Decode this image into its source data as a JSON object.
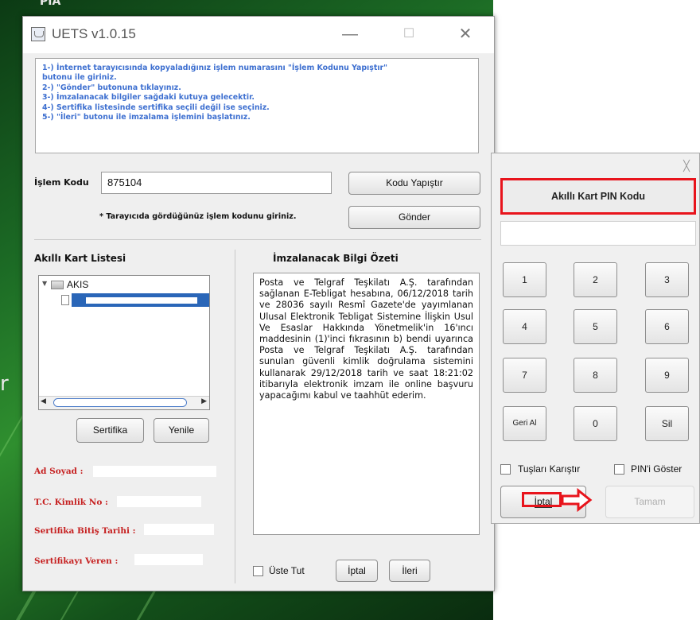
{
  "desktop": {
    "top_text": "PIA",
    "side_text": "r"
  },
  "window": {
    "title": "UETS v1.0.15",
    "minimize": "—",
    "maximize": "☐",
    "close": "✕"
  },
  "instructions": [
    "1-) İnternet tarayıcısında kopyaladığınız işlem numarasını \"İşlem Kodunu Yapıştır\"",
    "butonu ile giriniz.",
    "2-) \"Gönder\" butonuna tıklayınız.",
    "3-) İmzalanacak bilgiler sağdaki kutuya gelecektir.",
    "4-) Sertifika listesinde sertifika seçili değil ise seçiniz.",
    "5-) \"İleri\" butonu ile imzalama işlemini başlatınız."
  ],
  "form": {
    "code_label": "İşlem Kodu",
    "code_value": "875104",
    "paste_button": "Kodu Yapıştır",
    "hint": "* Tarayıcıda gördüğünüz işlem kodunu giriniz.",
    "send_button": "Gönder"
  },
  "cards": {
    "heading": "Akıllı Kart Listesi",
    "tree_root": "AKIS",
    "certificate_button": "Sertifika",
    "refresh_button": "Yenile"
  },
  "info_labels": {
    "name": "Ad Soyad :",
    "tc": "T.C. Kimlik No :",
    "expiry": "Sertifika Bitiş Tarihi :",
    "issuer": "Sertifikayı Veren :"
  },
  "summary": {
    "heading": "İmzalanacak Bilgi Özeti",
    "text": "Posta ve Telgraf Teşkilatı A.Ş. tarafından sağlanan E-Tebligat hesabına, 06/12/2018 tarih ve 28036 sayılı Resmî Gazete'de yayımlanan Ulusal Elektronik Tebligat Sistemine İlişkin Usul Ve Esaslar Hakkında Yönetmelik'in 16'ıncı maddesinin (1)'inci fıkrasının b) bendi uyarınca Posta ve Telgraf Teşkilatı A.Ş. tarafından sunulan güvenli kimlik doğrulama sistemini kullanarak 29/12/2018 tarih ve saat 18:21:02 itibarıyla elektronik imzam ile online başvuru yapacağımı kabul ve taahhüt ederim."
  },
  "bottom": {
    "stay_on_top": "Üste Tut",
    "cancel": "İptal",
    "next": "İleri"
  },
  "pin_dialog": {
    "close": "╳",
    "title": "Akıllı Kart PIN Kodu",
    "keys": [
      "1",
      "2",
      "3",
      "4",
      "5",
      "6",
      "7",
      "8",
      "9",
      "Geri Al",
      "0",
      "Sil"
    ],
    "shuffle_label": "Tuşları Karıştır",
    "show_pin_label": "PIN'i Göster",
    "cancel": "İptal",
    "ok": "Tamam"
  },
  "colors": {
    "highlight": "#e8141c",
    "instruction_text": "#3d6fd0",
    "label_red": "#c62020",
    "selection": "#2a66b8"
  }
}
